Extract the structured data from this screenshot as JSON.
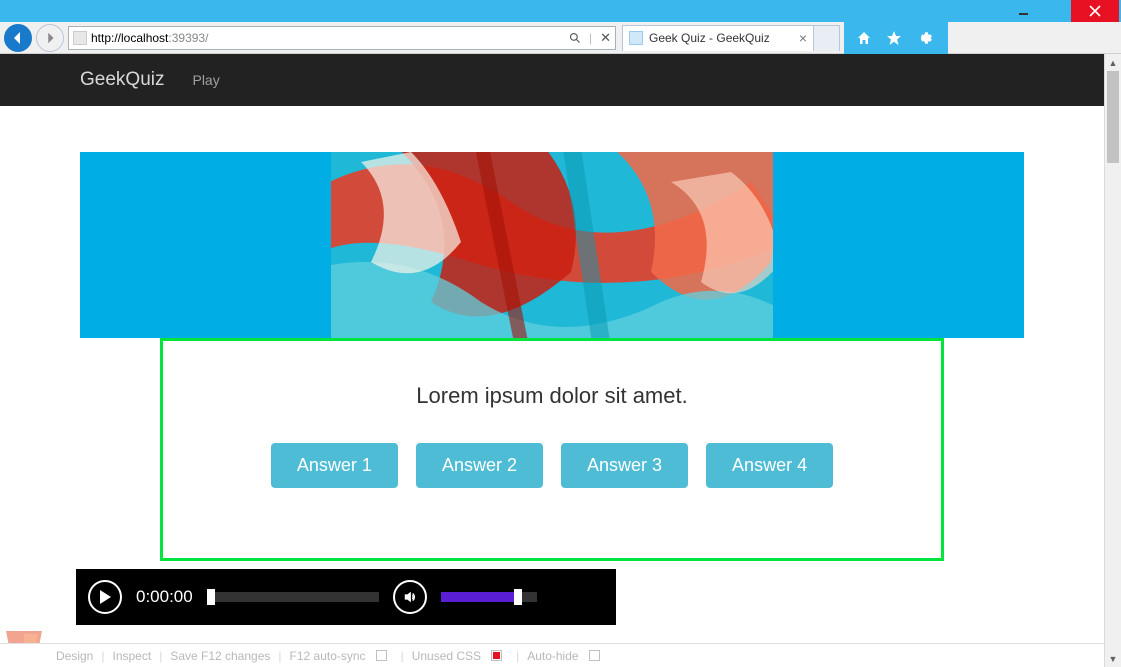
{
  "browser": {
    "url_host": "http://localhost",
    "url_port": ":39393/",
    "tab_title": "Geek Quiz - GeekQuiz"
  },
  "nav": {
    "brand": "GeekQuiz",
    "link_play": "Play"
  },
  "quiz": {
    "question": "Lorem ipsum dolor sit amet.",
    "answers": [
      "Answer 1",
      "Answer 2",
      "Answer 3",
      "Answer 4"
    ]
  },
  "player": {
    "time": "0:00:00"
  },
  "devbar": {
    "design": "Design",
    "inspect": "Inspect",
    "save": "Save F12 changes",
    "autosync": "F12 auto-sync",
    "unused": "Unused CSS",
    "autohide": "Auto-hide"
  }
}
